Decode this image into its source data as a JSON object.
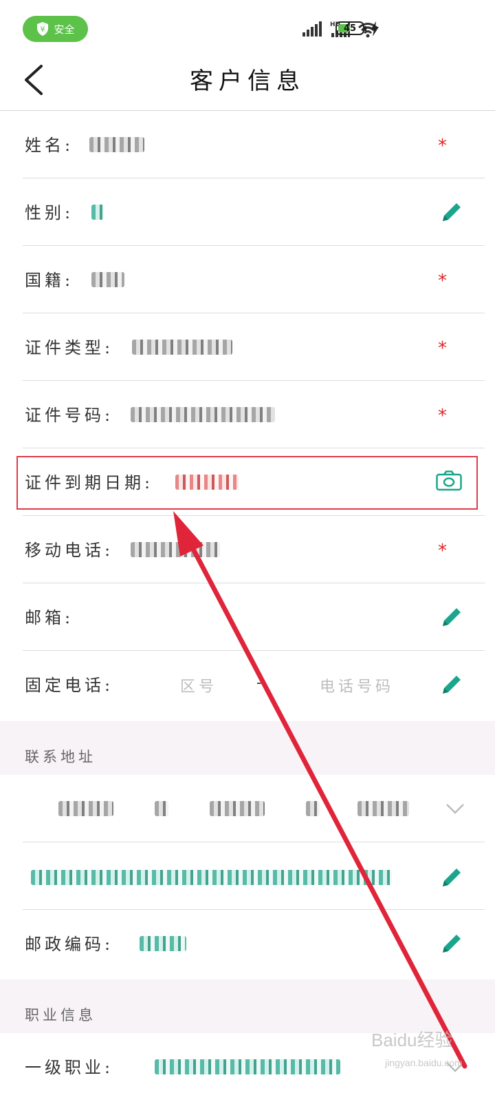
{
  "status_bar": {
    "safe_label": "安全",
    "battery_level": "45"
  },
  "header": {
    "title": "客户信息"
  },
  "form_rows": [
    {
      "label": "姓名:",
      "marker": "*"
    },
    {
      "label": "性别:"
    },
    {
      "label": "国籍:",
      "marker": "*"
    },
    {
      "label": "证件类型:",
      "marker": "*"
    },
    {
      "label": "证件号码:",
      "marker": "*"
    },
    {
      "label": "证件到期日期:"
    },
    {
      "label": "移动电话:",
      "marker": "*"
    },
    {
      "label": "邮箱:"
    },
    {
      "label": "固定电话:",
      "area_code_placeholder": "区号",
      "separator": "-",
      "phone_placeholder": "电话号码"
    }
  ],
  "sections": {
    "contact_address": "联系地址",
    "postal_code_label": "邮政编码:",
    "occupation": "职业信息",
    "first_level_occupation": "一级职业:"
  },
  "watermark": {
    "brand": "Baidu经验",
    "url": "jingyan.baidu.com"
  },
  "colors": {
    "accent_teal": "#1aa58c",
    "required_red": "#e02424",
    "highlight_red": "#e03a4a",
    "safe_green": "#5cc24a"
  },
  "icons": {
    "edit": "pencil-icon",
    "scan": "camera-icon",
    "expand": "chevron-down-icon",
    "back": "chevron-left-icon"
  }
}
